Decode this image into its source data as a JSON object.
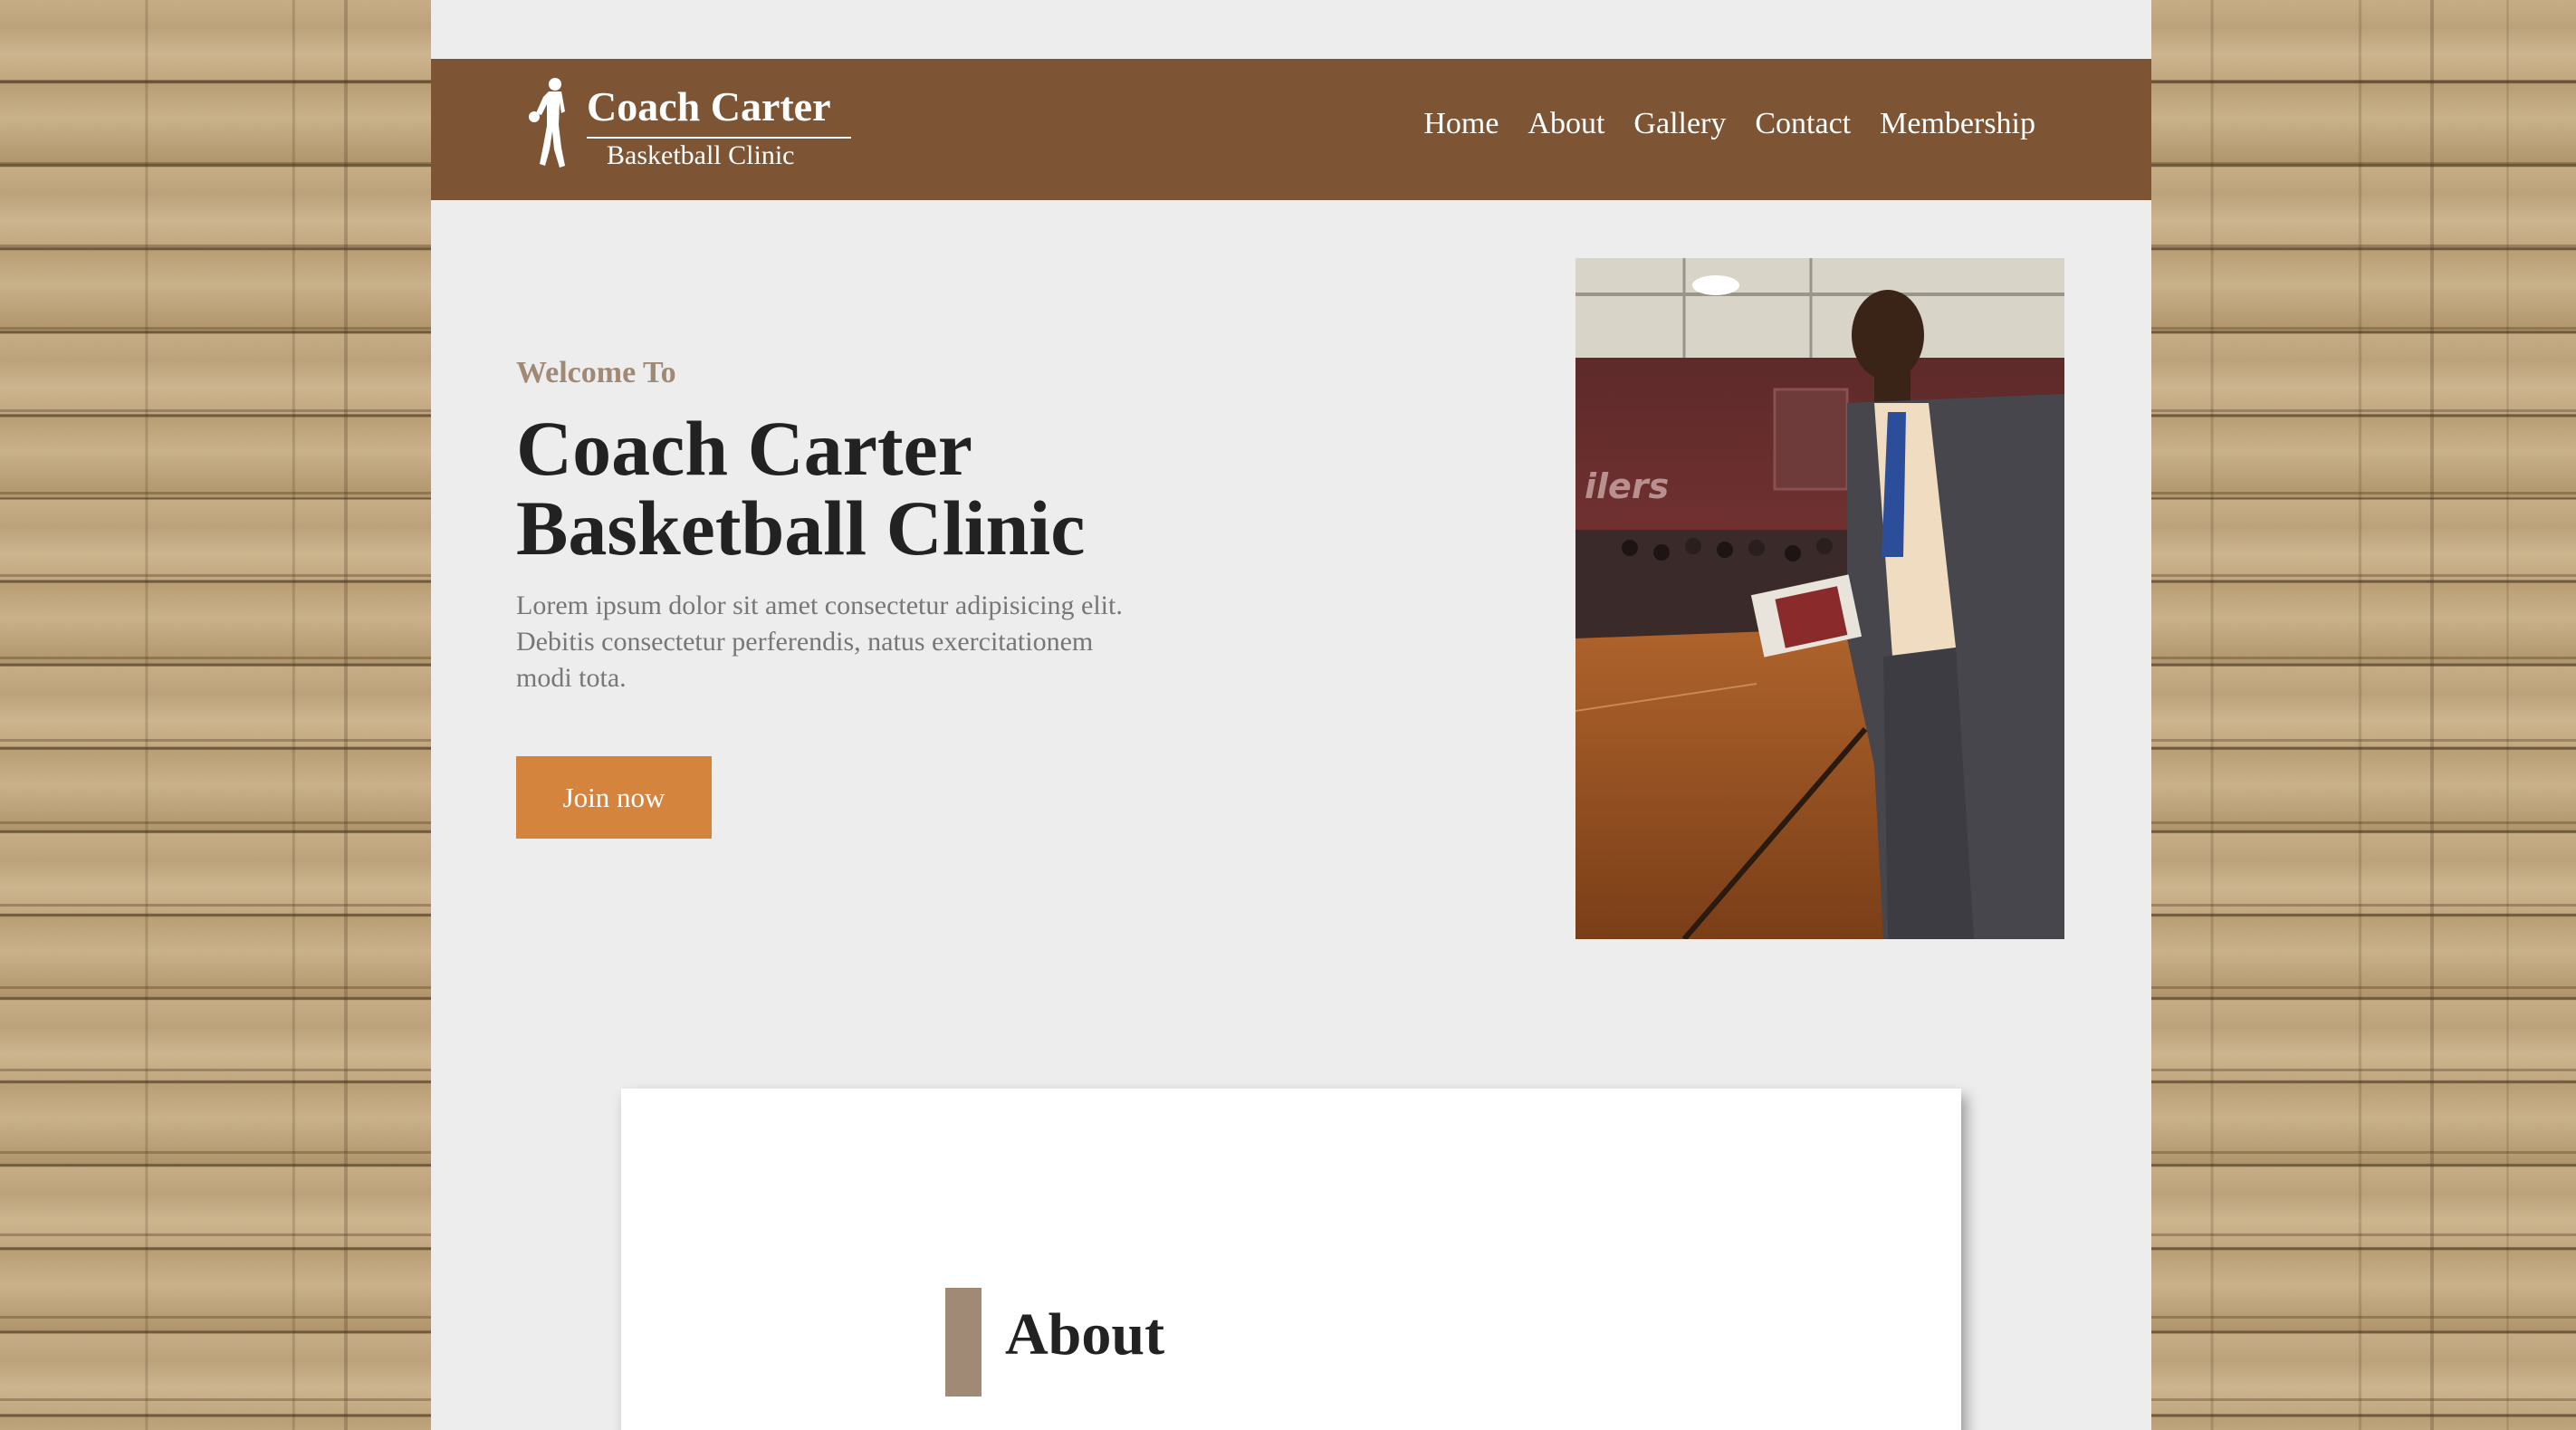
{
  "brand": {
    "title": "Coach Carter",
    "subtitle": "Basketball Clinic"
  },
  "nav": {
    "items": [
      {
        "label": "Home"
      },
      {
        "label": "About"
      },
      {
        "label": "Gallery"
      },
      {
        "label": "Contact"
      },
      {
        "label": "Membership"
      }
    ]
  },
  "hero": {
    "welcome": "Welcome To",
    "title_line1": "Coach Carter",
    "title_line2": "Basketball Clinic",
    "description": "Lorem ipsum dolor sit amet consectetur adipisicing elit. Debitis consectetur perferendis, natus exercitationem modi tota.",
    "button_label": "Join now"
  },
  "about": {
    "title": "About"
  },
  "colors": {
    "navbar": "#7d5535",
    "page_background": "#ededed",
    "accent_button": "#d4843c",
    "welcome_text": "#a08a76",
    "about_bar": "#a08a76"
  },
  "icons": {
    "logo": "basketball-player-silhouette-icon",
    "hero_image": "coach-in-gym-photo"
  }
}
